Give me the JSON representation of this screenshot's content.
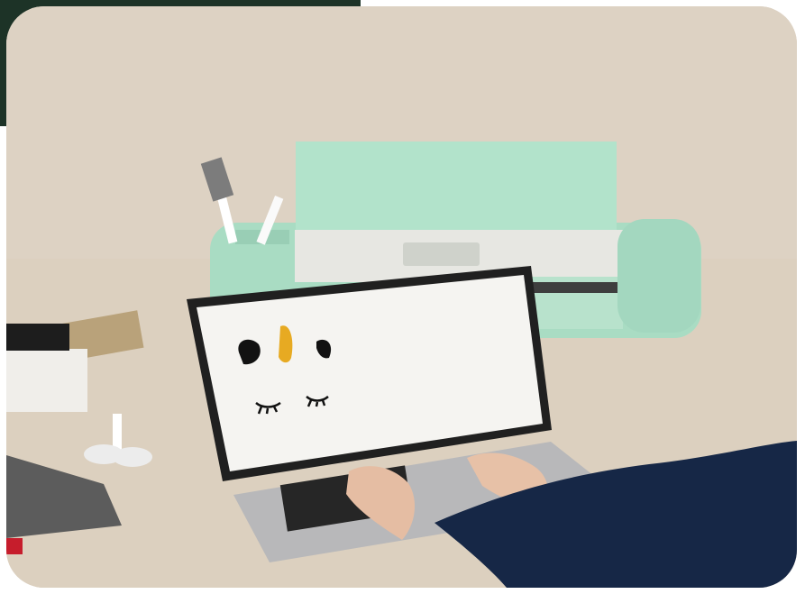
{
  "image": {
    "description_free": true,
    "accent_color": "#1d3327",
    "machine_color": "#a8dcc2",
    "logo_text": "",
    "screen_art": {
      "left_ear": "black-ear",
      "horn": "gold-horn",
      "right_ear": "black-ear",
      "left_eye": "closed-eye",
      "right_eye": "closed-eye"
    }
  }
}
